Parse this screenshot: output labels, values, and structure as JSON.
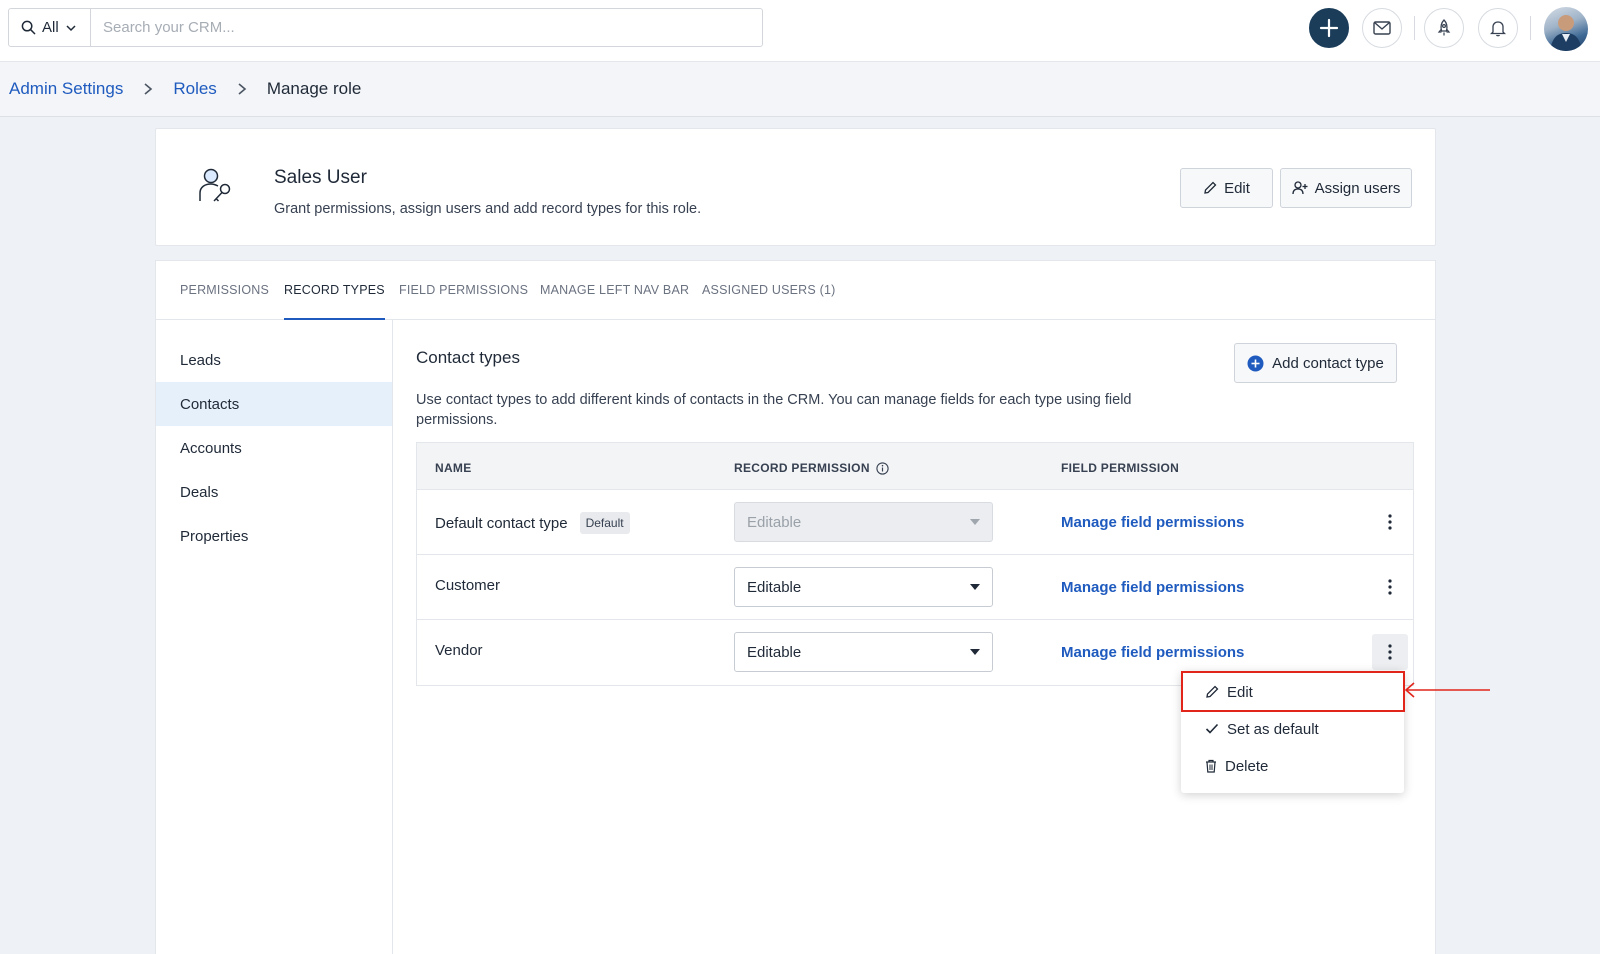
{
  "topbar": {
    "scope_label": "All",
    "search_placeholder": "Search your CRM..."
  },
  "breadcrumb": {
    "items": [
      "Admin Settings",
      "Roles"
    ],
    "current": "Manage role"
  },
  "role": {
    "title": "Sales User",
    "description": "Grant permissions, assign users and add record types for this role.",
    "edit_label": "Edit",
    "assign_label": "Assign users"
  },
  "tabs": [
    "PERMISSIONS",
    "RECORD TYPES",
    "FIELD PERMISSIONS",
    "MANAGE LEFT NAV BAR",
    "ASSIGNED USERS (1)"
  ],
  "active_tab": "RECORD TYPES",
  "nav": {
    "items": [
      "Leads",
      "Contacts",
      "Accounts",
      "Deals",
      "Properties"
    ],
    "active": "Contacts"
  },
  "section": {
    "title": "Contact types",
    "add_button": "Add contact type",
    "description": "Use contact types to add different kinds of contacts in the CRM. You can manage fields for each type using field permissions."
  },
  "table": {
    "headers": [
      "NAME",
      "RECORD PERMISSION",
      "FIELD PERMISSION"
    ],
    "rows": [
      {
        "name": "Default contact type",
        "badge": "Default",
        "permission": "Editable",
        "disabled": true,
        "link": "Manage field permissions"
      },
      {
        "name": "Customer",
        "badge": "",
        "permission": "Editable",
        "disabled": false,
        "link": "Manage field permissions"
      },
      {
        "name": "Vendor",
        "badge": "",
        "permission": "Editable",
        "disabled": false,
        "link": "Manage field permissions"
      }
    ]
  },
  "menu": {
    "items": [
      "Edit",
      "Set as default",
      "Delete"
    ]
  },
  "colors": {
    "accent": "#1f5bbf",
    "primary_button": "#1b3d5a",
    "highlight": "#e1251b",
    "active_nav_bg": "#e6f0fb"
  }
}
